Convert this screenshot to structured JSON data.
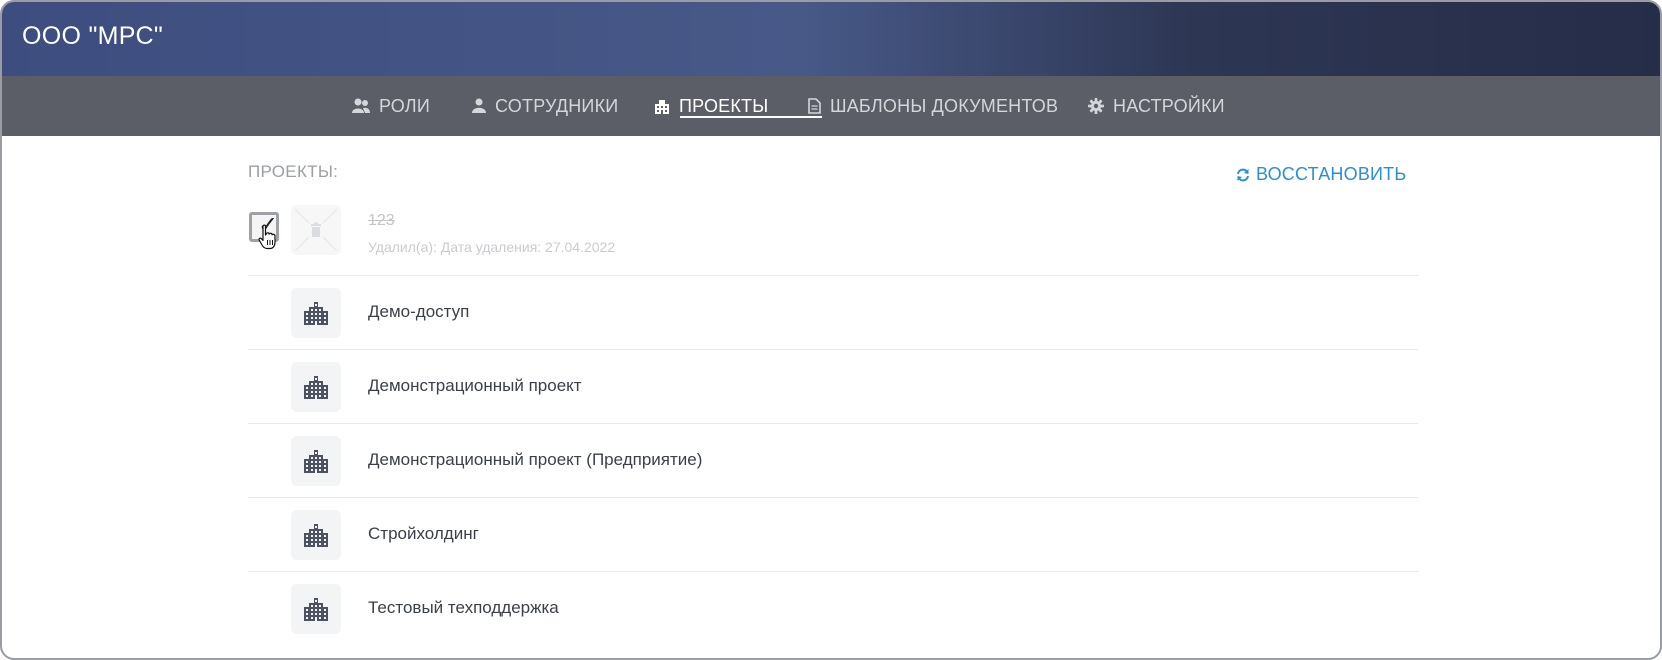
{
  "header": {
    "company": "ООО \"МРС\""
  },
  "nav": {
    "roles": {
      "label": "РОЛИ",
      "icon": "users-icon"
    },
    "employees": {
      "label": "СОТРУДНИКИ",
      "icon": "user-icon"
    },
    "projects": {
      "label": "ПРОЕКТЫ",
      "icon": "building-icon",
      "active": true
    },
    "templates": {
      "label": "ШАБЛОНЫ ДОКУМЕНТОВ",
      "icon": "document-icon"
    },
    "settings": {
      "label": "НАСТРОЙКИ",
      "icon": "gear-icon"
    }
  },
  "content": {
    "title": "ПРОЕКТЫ:",
    "restore_label": "ВОССТАНОВИТЬ",
    "deleted_project": {
      "name": "123",
      "meta": "Удалил(а): Дата удаления: 27.04.2022",
      "checked": true,
      "icon": "trash-icon"
    },
    "projects": [
      {
        "name": "Демо-доступ",
        "icon": "building-icon"
      },
      {
        "name": "Демонстрационный проект",
        "icon": "building-icon"
      },
      {
        "name": "Демонстрационный проект (Предприятие)",
        "icon": "building-icon"
      },
      {
        "name": "Стройхолдинг",
        "icon": "building-icon"
      },
      {
        "name": "Тестовый техподдержка",
        "icon": "building-icon"
      }
    ]
  },
  "colors": {
    "accent": "#2b8fd8",
    "header_start": "#3d4d7f",
    "header_end": "#262d48",
    "nav_bg": "#5b5e66",
    "project_icon": "#4c5260"
  }
}
